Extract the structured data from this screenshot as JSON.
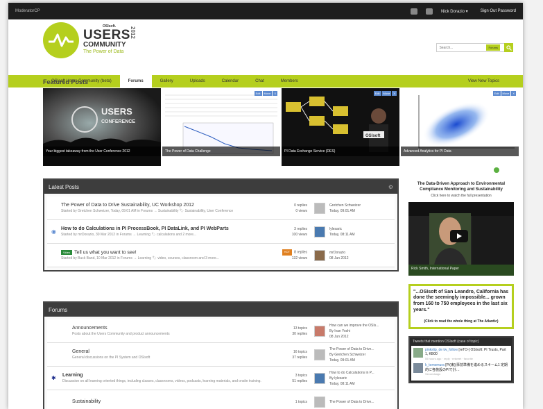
{
  "topbar": {
    "moderator": "ModeratorCP",
    "user": "Nick Dorazio ▾",
    "signout": "Sign Out Password"
  },
  "logo": {
    "osisoft": "OSIsoft.",
    "users": "USERS",
    "community": "COMMUNITY",
    "tagline": "The Power of Data",
    "year": "2012"
  },
  "search": {
    "placeholder": "Search...",
    "scope": "Forums"
  },
  "nav": {
    "items": [
      "OSIsoft Users Community (beta)",
      "Forums",
      "Gallery",
      "Uploads",
      "Calendar",
      "Chat",
      "Members"
    ],
    "active_index": 1,
    "new_topics": "View New Topics"
  },
  "featured": {
    "title": "Featured Posts",
    "cards": [
      {
        "caption": "Your biggest takeaway from the User Conference 2012",
        "overlay": "USERS CONFERENCE"
      },
      {
        "caption": "The Power of Data Challenge"
      },
      {
        "caption": "PI Data Exchange Service (DES)",
        "overlay": "OSIsoft"
      },
      {
        "caption": "Advanced Analytics for PI Data"
      }
    ],
    "button_labels": [
      "Edit",
      "Move",
      "X"
    ]
  },
  "latest": {
    "title": "Latest Posts",
    "posts": [
      {
        "title": "The Power of Data to Drive Sustainability, UC Workshop 2012",
        "meta": "Started by Gretchen Schweizer, Today, 09:01 AM in Forums → Sustainability  🏷 Sustainability, User Conference",
        "replies": "0 replies",
        "views": "0 views",
        "last_user": "Gretchen Schweizer",
        "last_time": "Today, 09:01 AM",
        "bold": false,
        "badge": ""
      },
      {
        "title": "How to do Calculations in PI ProcessBook, PI DataLink, and PI WebParts",
        "meta": "Started by mrDorazio, 30 Mar 2012 in Forums → Learning  🏷 calculations and 2 more...",
        "replies": "3 replies",
        "views": "100 views",
        "last_user": "lylesaric",
        "last_time": "Today, 08:11 AM",
        "bold": true,
        "badge": ""
      },
      {
        "title": "Tell us what you want to see!",
        "meta": "Started by Buck Band, 10 Mar 2012 in Forums → Learning  🏷 video, courses, classroom and 3 more...",
        "replies": "8 replies",
        "views": "132 views",
        "last_user": "mrDorazio",
        "last_time": "08 Jun 2012",
        "bold": false,
        "badge": "Video",
        "hot": "HOT"
      }
    ]
  },
  "forums": {
    "title": "Forums",
    "rows": [
      {
        "name": "Announcements",
        "desc": "Posts about the Users Community and product announcements",
        "topics": "13 topics",
        "replies": "30 replies",
        "last_title": "How can we improve the OSIs...",
        "last_by": "By Ivan Yoshi",
        "last_time": "08 Jun 2012",
        "bold": false
      },
      {
        "name": "General",
        "desc": "General discussions on the PI System and OSIsoft",
        "topics": "16 topics",
        "replies": "37 replies",
        "last_title": "The Power of Data to Drive...",
        "last_by": "By Gretchen Schweizer",
        "last_time": "Today, 09:01 AM",
        "bold": false
      },
      {
        "name": "Learning",
        "desc": "Discussion on all learning oriented things, including classes, classrooms, videos, podcasts, learning materials, and onsite training.",
        "topics": "3 topics",
        "replies": "51 replies",
        "last_title": "How to do Calculations in P...",
        "last_by": "By lylesaric",
        "last_time": "Today, 08:11 AM",
        "bold": true
      },
      {
        "name": "Sustainability",
        "desc": "",
        "topics": "1 topics",
        "replies": "",
        "last_title": "The Power of Data to Drive...",
        "last_by": "",
        "last_time": "",
        "bold": false
      }
    ]
  },
  "sidebar": {
    "promo_title": "The Data-Driven Approach to Environmental Compliance Monitoring and Sustainability",
    "promo_sub": "Click here to watch the full presentation",
    "video_caption": "Rick Smith, International Paper",
    "quote": "\"...OSIsoft of San Leandro, California has done the seemingly impossible... grown from 160 to 750 employees in the last six years.\"",
    "quote_link": "(Click to read the whole thing at The Atlantic)",
    "twitter_title": "Tweets that mention OSIsoft (case of topic)",
    "tweets": [
      {
        "user": "pinkslip_de",
        "handle": "tw_follow",
        "text": "[reTO-] OSIsoft: PI Trusts, Part 1, KB00",
        "meta": "55 hours ago · reply · retweet · favorite"
      },
      {
        "user": "k_tomomura",
        "handle": "",
        "text": "[PI(東)]事前準備を進めるスキーム1 定期的に各施設のPIで計…",
        "meta": "Secondsago"
      }
    ]
  },
  "colors": {
    "brand_green": "#b5cf1e",
    "dark": "#1e1e1e",
    "link_blue": "#5c8ad0"
  }
}
